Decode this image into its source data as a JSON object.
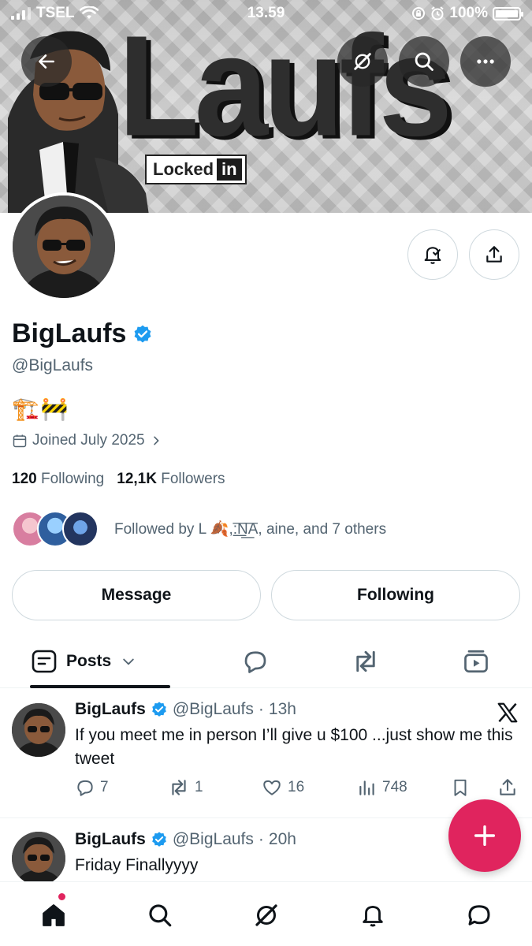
{
  "status_bar": {
    "carrier": "TSEL",
    "time": "13.59",
    "battery": "100%"
  },
  "banner": {
    "text": "Laufs",
    "badge_text": "Locked",
    "badge_suffix": "in"
  },
  "profile": {
    "display_name": "BigLaufs",
    "handle": "@BigLaufs",
    "bio": "🏗️🚧",
    "joined": "Joined July 2025",
    "following_count": "120",
    "following_label": "Following",
    "followers_count": "12,1K",
    "followers_label": "Followers",
    "followed_by": "Followed by L 🍂,:͟͟͞N͟͞A, aine, and 7 others"
  },
  "buttons": {
    "message": "Message",
    "following": "Following"
  },
  "tabs": {
    "posts": "Posts"
  },
  "posts": [
    {
      "name": "BigLaufs",
      "handle": "@BigLaufs",
      "time": "13h",
      "text": "If you meet me in person I’ll give u $100 ...just show me this tweet",
      "replies": "7",
      "reposts": "1",
      "likes": "16",
      "views": "748"
    },
    {
      "name": "BigLaufs",
      "handle": "@BigLaufs",
      "time": "20h",
      "text": "Friday Finallyyyy"
    }
  ],
  "colors": {
    "accent": "#1d9bf0",
    "fab": "#e0245e",
    "text_primary": "#0f1419",
    "text_secondary": "#536471"
  }
}
